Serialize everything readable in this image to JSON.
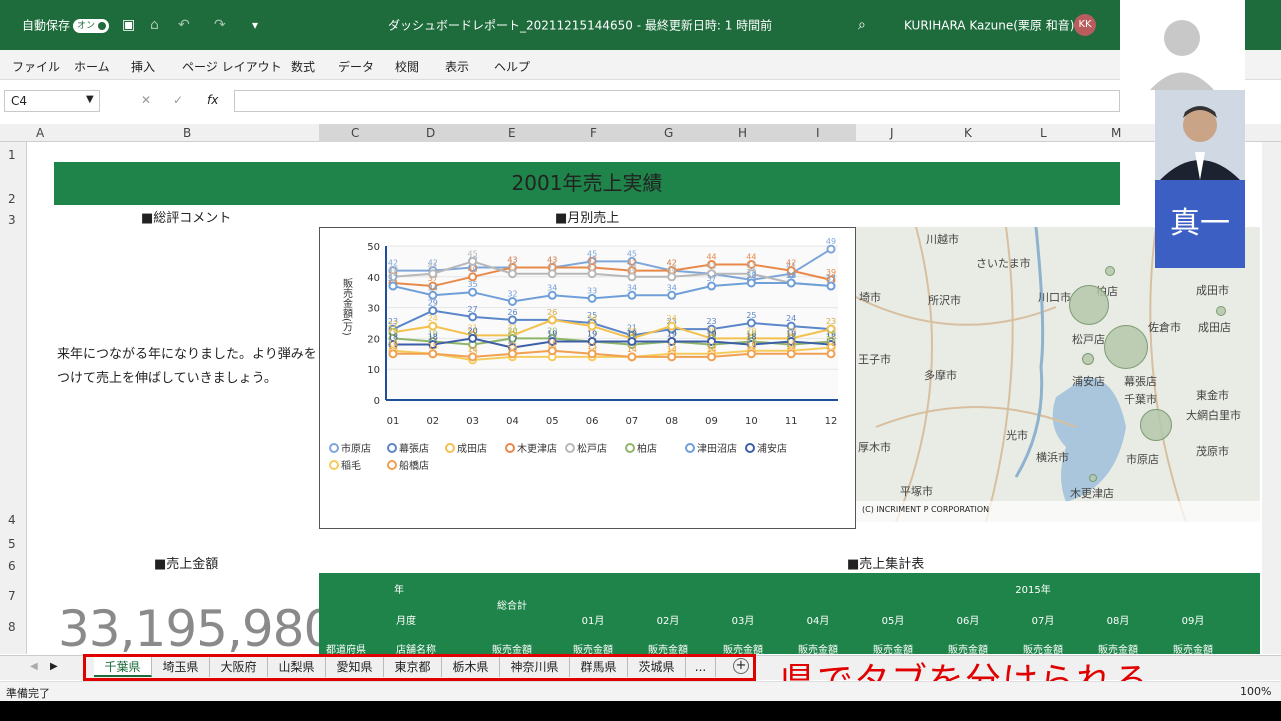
{
  "titlebar": {
    "autosave_label": "自動保存",
    "autosave_state": "オン",
    "doc_title": "ダッシュボードレポート_20211215144650 - 最終更新日時: 1 時間前",
    "user_name": "KURIHARA Kazune(栗原 和音)",
    "user_initials": "KK"
  },
  "menu": [
    "ファイル",
    "ホーム",
    "挿入",
    "ページ レイアウト",
    "数式",
    "データ",
    "校閲",
    "表示",
    "ヘルプ"
  ],
  "formula": {
    "name_box": "C4",
    "fx": "fx"
  },
  "columns": [
    "A",
    "B",
    "C",
    "D",
    "E",
    "F",
    "G",
    "H",
    "I",
    "J",
    "K",
    "L",
    "M"
  ],
  "rows": [
    "1",
    "2",
    "3",
    "4",
    "5",
    "6",
    "7",
    "8"
  ],
  "sheet": {
    "title": "2001年売上実績",
    "comment_header": "■総評コメント",
    "comment_text": "来年につながる年になりました。より弾みをつけて売上を伸ばしていきましょう。",
    "chart_header": "■月別売上",
    "sales_header": "■売上金額",
    "sales_value": "33,195,980",
    "table_header": "■売上集計表",
    "map_credit": "(C) INCRIMENT P CORPORATION"
  },
  "map": {
    "labels": [
      "川越市",
      "さいたま市",
      "所沢市",
      "川口市",
      "柏店",
      "成田市",
      "佐倉市",
      "成田店",
      "松戸店",
      "浦安店",
      "幕張店",
      "千葉市",
      "東金市",
      "大網白里市",
      "茂原市",
      "多摩市",
      "王子市",
      "厚木市",
      "横浜市",
      "平塚市",
      "市原店",
      "木更津店",
      "光市",
      "埼市"
    ]
  },
  "table": {
    "year_label": "年",
    "month_label": "月度",
    "total_label": "総合計",
    "year_value": "2015年",
    "months": [
      "01月",
      "02月",
      "03月",
      "04月",
      "05月",
      "06月",
      "07月",
      "08月",
      "09月"
    ],
    "pref_label": "都道府県",
    "store_label": "店舗名称",
    "amount_label": "販売金額"
  },
  "tabs": [
    "千葉県",
    "埼玉県",
    "大阪府",
    "山梨県",
    "愛知県",
    "東京都",
    "栃木県",
    "神奈川県",
    "群馬県",
    "茨城県",
    "..."
  ],
  "active_tab": "千葉県",
  "annotation": "県でタブを分けられる",
  "status": {
    "ready": "準備完了",
    "zoom": "100%"
  },
  "video": {
    "name_tag": "真一"
  },
  "colors": {
    "excel_green": "#1e6b3c",
    "banner_green": "#1e8449",
    "annotation_red": "#e00000"
  },
  "chart_data": {
    "type": "line",
    "ylabel": "販売金額(万)",
    "ylim": [
      0,
      50
    ],
    "yticks": [
      0,
      10,
      20,
      30,
      40,
      50
    ],
    "categories": [
      "01月",
      "02月",
      "03月",
      "04月",
      "05月",
      "06月",
      "07月",
      "08月",
      "09月",
      "10月",
      "11月",
      "12月"
    ],
    "series": [
      {
        "name": "市原店",
        "color": "#7fa6d9",
        "values": [
          42,
          42,
          43,
          43,
          43,
          45,
          45,
          42,
          41,
          39,
          41,
          49
        ]
      },
      {
        "name": "幕張店",
        "color": "#5b86c9",
        "values": [
          23,
          29,
          27,
          26,
          26,
          25,
          21,
          23,
          23,
          25,
          24,
          23
        ]
      },
      {
        "name": "成田店",
        "color": "#f2c14e",
        "values": [
          22,
          24,
          21,
          21,
          26,
          24,
          20,
          24,
          20,
          20,
          20,
          23
        ]
      },
      {
        "name": "木更津店",
        "color": "#e8894a",
        "values": [
          38,
          37,
          40,
          43,
          43,
          43,
          42,
          42,
          44,
          44,
          42,
          39
        ]
      },
      {
        "name": "松戸店",
        "color": "#b8b8b8",
        "values": [
          40,
          41,
          45,
          41,
          41,
          41,
          40,
          40,
          41,
          41,
          38,
          37
        ]
      },
      {
        "name": "柏店",
        "color": "#8fb569",
        "values": [
          20,
          19,
          18,
          20,
          20,
          19,
          18,
          19,
          18,
          19,
          18,
          19
        ]
      },
      {
        "name": "津田沼店",
        "color": "#6f9fd8",
        "values": [
          37,
          34,
          35,
          32,
          34,
          33,
          34,
          34,
          37,
          38,
          38,
          37
        ]
      },
      {
        "name": "浦安店",
        "color": "#3d5fa8",
        "values": [
          18,
          18,
          20,
          17,
          19,
          19,
          19,
          19,
          19,
          18,
          19,
          18
        ]
      },
      {
        "name": "稲毛",
        "color": "#f5cc5c",
        "values": [
          16,
          15,
          13,
          14,
          14,
          14,
          14,
          15,
          15,
          16,
          16,
          17
        ]
      },
      {
        "name": "船橋店",
        "color": "#f0a050",
        "values": [
          15,
          15,
          14,
          15,
          16,
          15,
          14,
          14,
          14,
          15,
          15,
          15
        ]
      }
    ]
  }
}
